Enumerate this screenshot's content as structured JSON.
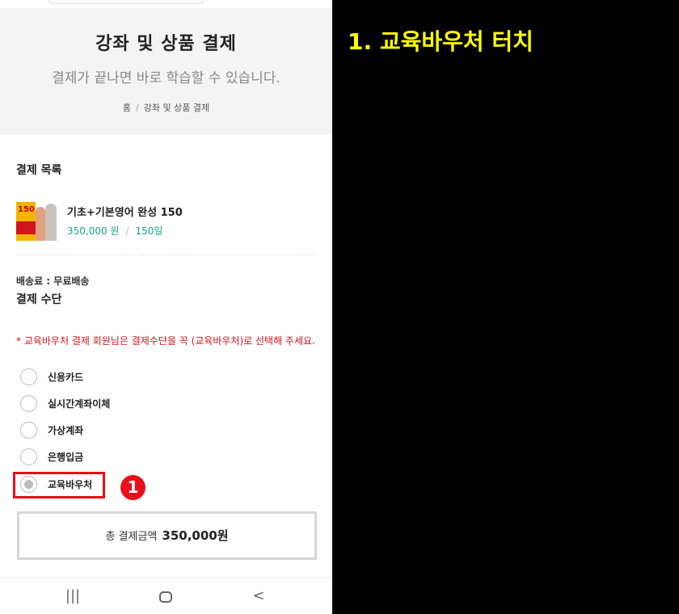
{
  "header": {
    "title": "강좌 및 상품 결제",
    "subtitle": "결제가 끝나면 바로 학습할 수 있습니다.",
    "breadcrumb": {
      "home": "홈",
      "separator": "/",
      "current": "강좌 및 상품 결제"
    }
  },
  "order": {
    "section_title": "결제 목록",
    "item": {
      "name": "기초+기본영어 완성 150",
      "price": "350,000 원",
      "separator": "/",
      "duration": "150일",
      "thumb_text": "150"
    }
  },
  "shipping_label": "배송료 : 무료배송",
  "payment": {
    "title": "결제 수단",
    "notice": "* 교육바우처 결제 회원님은 결제수단을 꼭 (교육바우처)로 선택해 주세요.",
    "options": [
      {
        "label": "신용카드",
        "selected": false
      },
      {
        "label": "실시간계좌이체",
        "selected": false
      },
      {
        "label": "가상계좌",
        "selected": false
      },
      {
        "label": "은행입금",
        "selected": false
      },
      {
        "label": "교육바우처",
        "selected": true
      }
    ]
  },
  "total": {
    "label": "총 결제금액",
    "amount": "350,000원"
  },
  "annotation": {
    "step_marker": "1",
    "instruction": "1. 교육바우처 터치",
    "highlight_color": "#e8101a",
    "instruction_color": "#ffff00"
  },
  "navbar": {
    "recent_icon": "recent-apps-icon",
    "home_icon": "home-icon",
    "back_icon": "back-icon"
  },
  "colors": {
    "accent_green": "#1aa18a",
    "notice_red": "#d0151c"
  }
}
